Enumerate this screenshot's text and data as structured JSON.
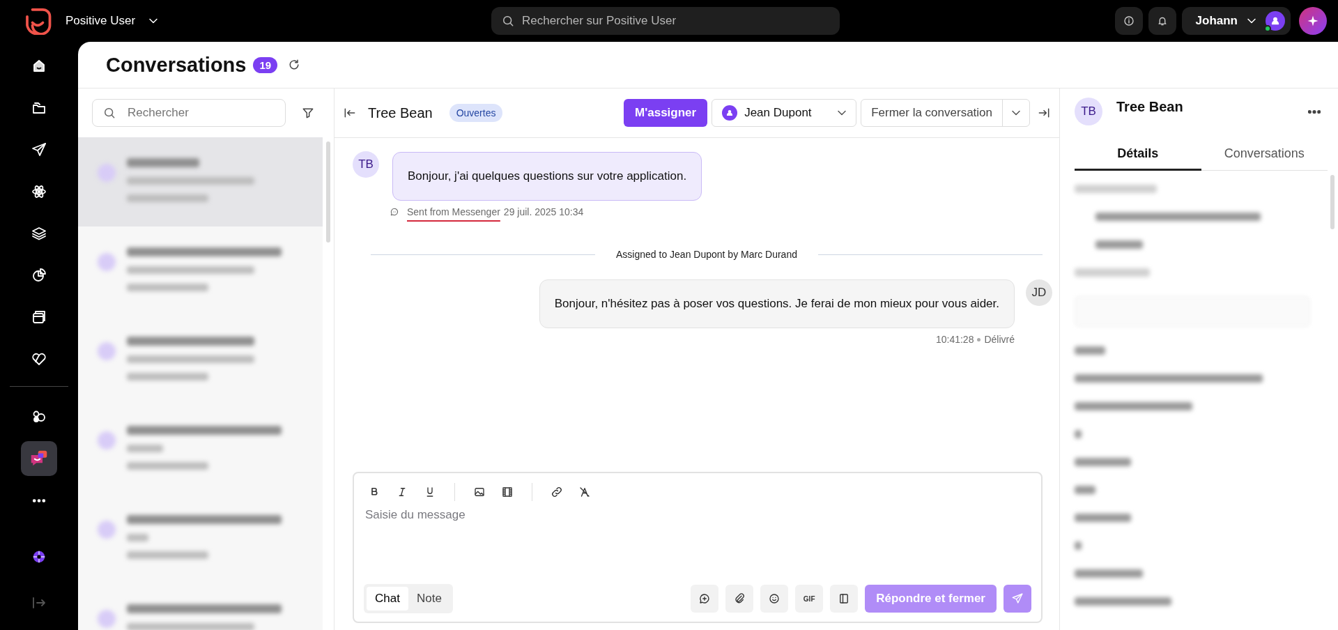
{
  "app": {
    "name": "Positive User"
  },
  "search": {
    "placeholder": "Rechercher sur Positive User"
  },
  "user": {
    "name": "Johann",
    "online": true
  },
  "nav": [
    {
      "kind": "home",
      "selected": false
    },
    {
      "kind": "folder",
      "selected": false
    },
    {
      "kind": "send",
      "selected": false
    },
    {
      "kind": "atom",
      "selected": false
    },
    {
      "kind": "layers",
      "selected": false
    },
    {
      "kind": "pie",
      "selected": false
    },
    {
      "kind": "windows",
      "selected": false
    },
    {
      "kind": "heart",
      "selected": false
    },
    {
      "kind": "divider"
    },
    {
      "kind": "bubbles",
      "selected": false
    },
    {
      "kind": "chat",
      "selected": true
    },
    {
      "kind": "more",
      "selected": false
    }
  ],
  "page": {
    "title": "Conversations",
    "count": "19"
  },
  "list": {
    "search_placeholder": "Rechercher",
    "items": [
      {
        "selected": true
      },
      {
        "selected": false
      },
      {
        "selected": false
      },
      {
        "selected": false
      },
      {
        "selected": false
      },
      {
        "selected": false
      }
    ]
  },
  "chat": {
    "contact": "Tree Bean",
    "status": "Ouvertes",
    "assign_button": "M'assigner",
    "assignee": "Jean Dupont",
    "close_button": "Fermer la conversation",
    "messages": [
      {
        "kind": "incoming",
        "avatar": "TB",
        "text": "Bonjour, j'ai quelques questions sur votre application.",
        "source": "Sent from Messenger",
        "time": "29 juil. 2025 10:34"
      },
      {
        "kind": "event",
        "text": "Assigned to Jean Dupont by Marc Durand"
      },
      {
        "kind": "outgoing",
        "avatar": "JD",
        "text": "Bonjour, n'hésitez pas à poser vos questions. Je ferai de mon mieux pour vous aider.",
        "time": "10:41:28",
        "status": "Délivré"
      }
    ]
  },
  "composer": {
    "placeholder": "Saisie du message",
    "modes": [
      {
        "label": "Chat",
        "selected": true
      },
      {
        "label": "Note",
        "selected": false
      }
    ],
    "gif": "GIF",
    "submit": "Répondre et fermer"
  },
  "details": {
    "avatar": "TB",
    "name": "Tree Bean",
    "tabs": [
      {
        "label": "Détails",
        "selected": true
      },
      {
        "label": "Conversations",
        "selected": false
      }
    ]
  }
}
